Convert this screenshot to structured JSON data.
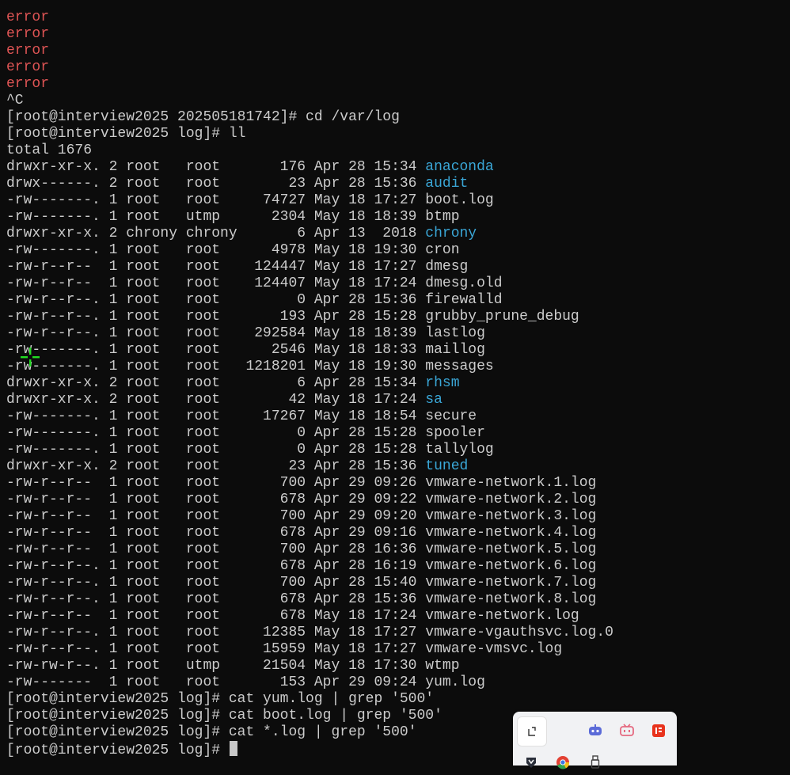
{
  "terminal": {
    "error_lines": [
      "error",
      "error",
      "error",
      "error",
      "error"
    ],
    "interrupt": "^C",
    "cd_command": "[root@interview2025 202505181742]# cd /var/log",
    "ll_command": "[root@interview2025 log]# ll",
    "total": "total 1676",
    "entries": [
      {
        "meta": "drwxr-xr-x. 2 root   root       176 Apr 28 15:34 ",
        "name": "anaconda",
        "is_dir": true
      },
      {
        "meta": "drwx------. 2 root   root        23 Apr 28 15:36 ",
        "name": "audit",
        "is_dir": true
      },
      {
        "meta": "-rw-------. 1 root   root     74727 May 18 17:27 ",
        "name": "boot.log",
        "is_dir": false
      },
      {
        "meta": "-rw-------. 1 root   utmp      2304 May 18 18:39 ",
        "name": "btmp",
        "is_dir": false
      },
      {
        "meta": "drwxr-xr-x. 2 chrony chrony       6 Apr 13  2018 ",
        "name": "chrony",
        "is_dir": true
      },
      {
        "meta": "-rw-------. 1 root   root      4978 May 18 19:30 ",
        "name": "cron",
        "is_dir": false
      },
      {
        "meta": "-rw-r--r--  1 root   root    124447 May 18 17:27 ",
        "name": "dmesg",
        "is_dir": false
      },
      {
        "meta": "-rw-r--r--  1 root   root    124407 May 18 17:24 ",
        "name": "dmesg.old",
        "is_dir": false
      },
      {
        "meta": "-rw-r--r--. 1 root   root         0 Apr 28 15:36 ",
        "name": "firewalld",
        "is_dir": false
      },
      {
        "meta": "-rw-r--r--. 1 root   root       193 Apr 28 15:28 ",
        "name": "grubby_prune_debug",
        "is_dir": false
      },
      {
        "meta": "-rw-r--r--. 1 root   root    292584 May 18 18:39 ",
        "name": "lastlog",
        "is_dir": false
      },
      {
        "meta": "-rw-------. 1 root   root      2546 May 18 18:33 ",
        "name": "maillog",
        "is_dir": false
      },
      {
        "meta": "-rw-------. 1 root   root   1218201 May 18 19:30 ",
        "name": "messages",
        "is_dir": false
      },
      {
        "meta": "drwxr-xr-x. 2 root   root         6 Apr 28 15:34 ",
        "name": "rhsm",
        "is_dir": true
      },
      {
        "meta": "drwxr-xr-x. 2 root   root        42 May 18 17:24 ",
        "name": "sa",
        "is_dir": true
      },
      {
        "meta": "-rw-------. 1 root   root     17267 May 18 18:54 ",
        "name": "secure",
        "is_dir": false
      },
      {
        "meta": "-rw-------. 1 root   root         0 Apr 28 15:28 ",
        "name": "spooler",
        "is_dir": false
      },
      {
        "meta": "-rw-------. 1 root   root         0 Apr 28 15:28 ",
        "name": "tallylog",
        "is_dir": false
      },
      {
        "meta": "drwxr-xr-x. 2 root   root        23 Apr 28 15:36 ",
        "name": "tuned",
        "is_dir": true
      },
      {
        "meta": "-rw-r--r--  1 root   root       700 Apr 29 09:26 ",
        "name": "vmware-network.1.log",
        "is_dir": false
      },
      {
        "meta": "-rw-r--r--  1 root   root       678 Apr 29 09:22 ",
        "name": "vmware-network.2.log",
        "is_dir": false
      },
      {
        "meta": "-rw-r--r--  1 root   root       700 Apr 29 09:20 ",
        "name": "vmware-network.3.log",
        "is_dir": false
      },
      {
        "meta": "-rw-r--r--  1 root   root       678 Apr 29 09:16 ",
        "name": "vmware-network.4.log",
        "is_dir": false
      },
      {
        "meta": "-rw-r--r--  1 root   root       700 Apr 28 16:36 ",
        "name": "vmware-network.5.log",
        "is_dir": false
      },
      {
        "meta": "-rw-r--r--. 1 root   root       678 Apr 28 16:19 ",
        "name": "vmware-network.6.log",
        "is_dir": false
      },
      {
        "meta": "-rw-r--r--. 1 root   root       700 Apr 28 15:40 ",
        "name": "vmware-network.7.log",
        "is_dir": false
      },
      {
        "meta": "-rw-r--r--. 1 root   root       678 Apr 28 15:36 ",
        "name": "vmware-network.8.log",
        "is_dir": false
      },
      {
        "meta": "-rw-r--r--  1 root   root       678 May 18 17:24 ",
        "name": "vmware-network.log",
        "is_dir": false
      },
      {
        "meta": "-rw-r--r--. 1 root   root     12385 May 18 17:27 ",
        "name": "vmware-vgauthsvc.log.0",
        "is_dir": false
      },
      {
        "meta": "-rw-r--r--. 1 root   root     15959 May 18 17:27 ",
        "name": "vmware-vmsvc.log",
        "is_dir": false
      },
      {
        "meta": "-rw-rw-r--. 1 root   utmp     21504 May 18 17:30 ",
        "name": "wtmp",
        "is_dir": false
      },
      {
        "meta": "-rw-------  1 root   root       153 Apr 29 09:24 ",
        "name": "yum.log",
        "is_dir": false
      }
    ],
    "commands": [
      "[root@interview2025 log]# cat yum.log | grep '500'",
      "[root@interview2025 log]# cat boot.log | grep '500'",
      "[root@interview2025 log]# cat *.log | grep '500'"
    ],
    "prompt": "[root@interview2025 log]# ",
    "colors": {
      "background": "#0c0c0c",
      "text": "#cccccc",
      "error": "#e05555",
      "directory": "#3aa6d6"
    }
  },
  "tray": {
    "icons": [
      "puzzle-icon",
      "robot-icon",
      "tv-icon",
      "news-icon",
      "shield-icon",
      "chrome-icon",
      "usb-icon"
    ]
  }
}
